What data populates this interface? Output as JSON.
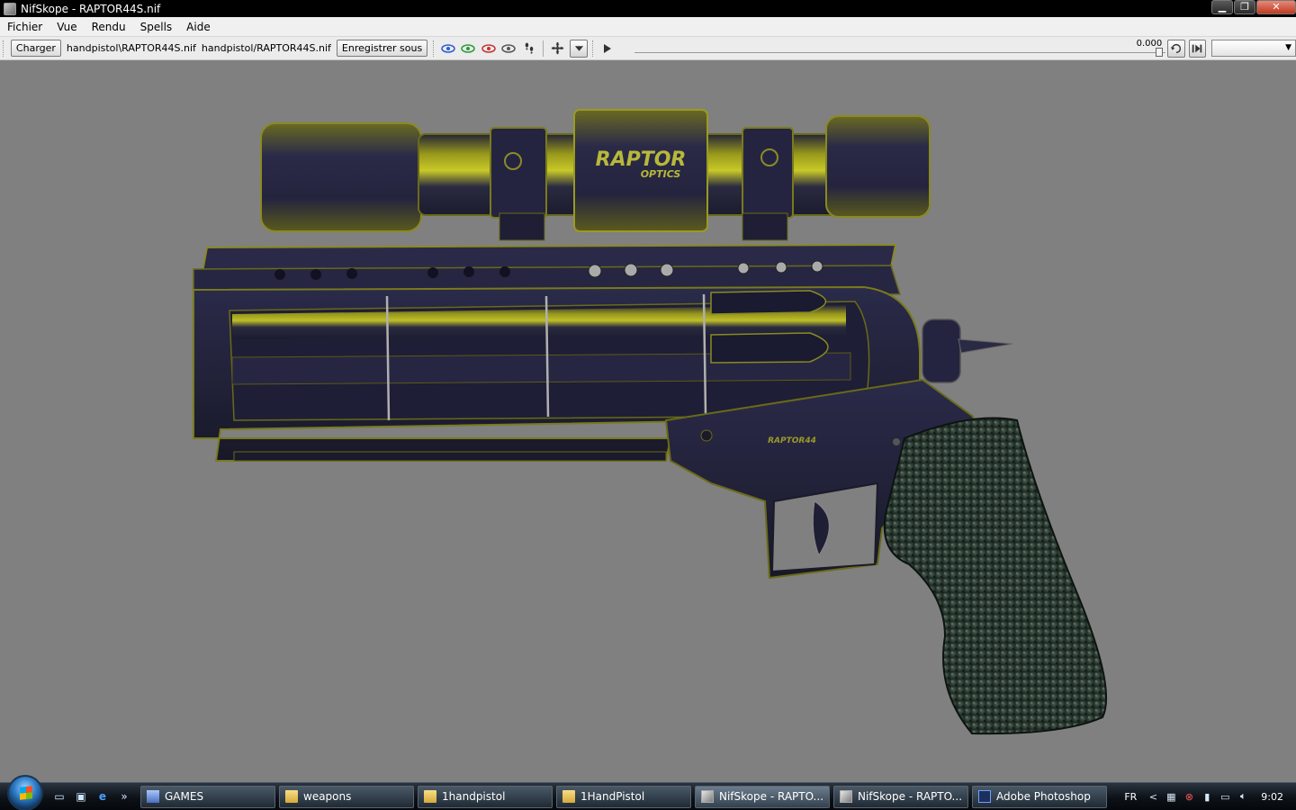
{
  "window": {
    "title": "NifSkope - RAPTOR44S.nif",
    "controls": {
      "minimize": "▁",
      "restore": "❐",
      "close": "✕"
    }
  },
  "menu": [
    "Fichier",
    "Vue",
    "Rendu",
    "Spells",
    "Aide"
  ],
  "toolbar": {
    "load_label": "Charger",
    "load_path": "handpistol\\RAPTOR44S.nif",
    "save_path": "handpistol/RAPTOR44S.nif",
    "save_as_label": "Enregistrer sous",
    "view_icons": [
      "eye-blue-icon",
      "eye-green-icon",
      "eye-red-icon",
      "eye-gray-icon",
      "footsteps-icon",
      "move-cross-icon",
      "dropdown-arrow-icon"
    ],
    "play_icon": "play-icon",
    "time_value": "0.000",
    "loop_icon": "loop-icon",
    "switch_icon": "switch-icon",
    "animation_select": ""
  },
  "model": {
    "scope_brand": "RAPTOR",
    "scope_sub": "OPTICS",
    "frame_label": "RAPTOR44"
  },
  "taskbar": {
    "quicklaunch": [
      "show-desktop-icon",
      "switch-windows-icon",
      "internet-explorer-icon"
    ],
    "overflow": "»",
    "tasks": [
      {
        "label": "GAMES",
        "icon": "games"
      },
      {
        "label": "weapons",
        "icon": "folder"
      },
      {
        "label": "1handpistol",
        "icon": "folder"
      },
      {
        "label": "1HandPistol",
        "icon": "folder"
      },
      {
        "label": "NifSkope - RAPTO...",
        "icon": "app"
      },
      {
        "label": "NifSkope - RAPTO...",
        "icon": "app"
      },
      {
        "label": "Adobe Photoshop",
        "icon": "ps"
      }
    ],
    "language": "FR",
    "tray_expand": "<",
    "clock": "9:02"
  }
}
